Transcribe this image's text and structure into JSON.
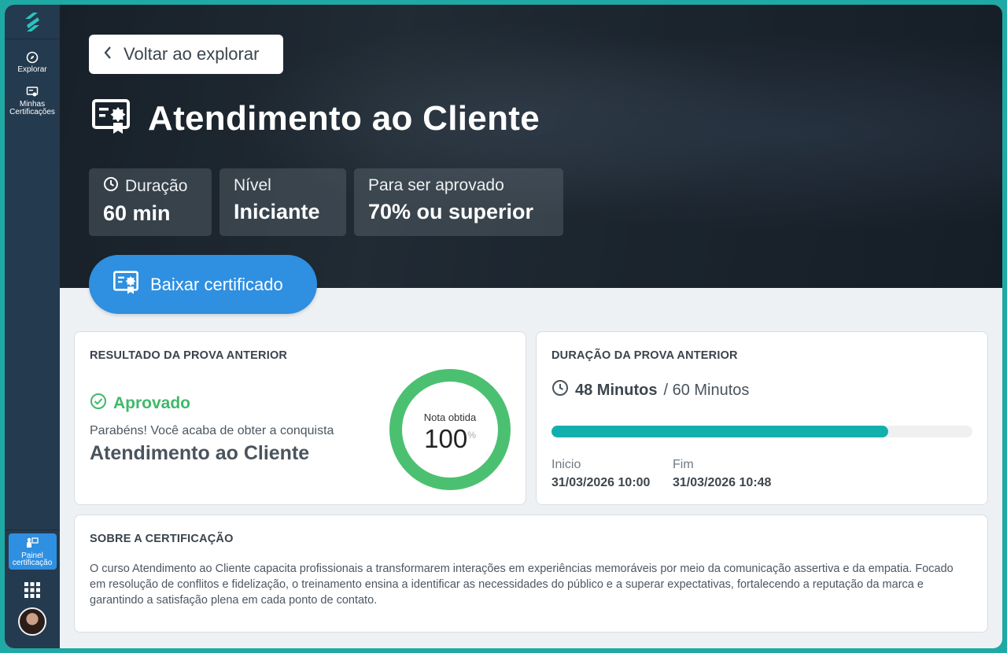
{
  "sidebar": {
    "items": [
      {
        "label": "Explorar",
        "icon": "compass-icon"
      },
      {
        "label": "Minhas Certificações",
        "icon": "certificate-icon"
      }
    ],
    "active_item": {
      "label": "Painel certificação",
      "icon": "presenter-icon"
    }
  },
  "hero": {
    "back_label": "Voltar ao explorar",
    "title": "Atendimento ao Cliente",
    "stats": [
      {
        "label": "Duração",
        "value": "60 min"
      },
      {
        "label": "Nível",
        "value": "Iniciante"
      },
      {
        "label": "Para ser aprovado",
        "value": "70% ou superior"
      }
    ],
    "download_label": "Baixar certificado"
  },
  "result": {
    "title": "RESULTADO DA PROVA ANTERIOR",
    "status": "Aprovado",
    "congrats": "Parabéns! Você acaba de obter a conquista",
    "conquest": "Atendimento ao Cliente",
    "score_label": "Nota obtida",
    "score": "100",
    "score_unit": "%",
    "score_fraction": 1.0
  },
  "duration": {
    "title": "DURAÇÃO DA PROVA ANTERIOR",
    "used": "48 Minutos",
    "total": "/ 60 Minutos",
    "progress": 0.8,
    "start_label": "Inicio",
    "start_value": "31/03/2026 10:00",
    "end_label": "Fim",
    "end_value": "31/03/2026 10:48"
  },
  "about": {
    "title": "SOBRE A CERTIFICAÇÃO",
    "text": "O curso Atendimento ao Cliente capacita profissionais a transformarem interações em experiências memoráveis por meio da comunicação assertiva e da empatia. Focado em resolução de conflitos e fidelização, o treinamento ensina a identificar as necessidades do público e a superar expectativas, fortalecendo a reputação da marca e garantindo a satisfação plena em cada ponto de contato."
  },
  "colors": {
    "accent": "#2f8fe0",
    "success": "#3fb96a",
    "progress": "#12b0ad",
    "sidebar": "#243a4e"
  }
}
